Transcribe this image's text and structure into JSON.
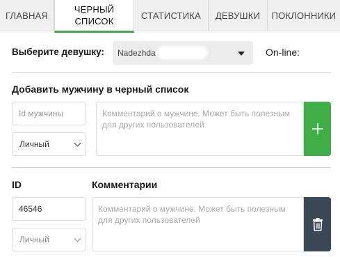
{
  "tabs": [
    {
      "label": "ГЛАВНАЯ"
    },
    {
      "label_line1": "ЧЕРНЫЙ",
      "label_line2": "СПИСОК",
      "active": true
    },
    {
      "label": "СТАТИСТИКА"
    },
    {
      "label": "ДЕВУШКИ"
    },
    {
      "label": "ПОКЛОННИКИ"
    }
  ],
  "girl_select": {
    "label": "Выберите девушку:",
    "value": "Nadezhda S",
    "online_label": "On-line:"
  },
  "add_section": {
    "title": "Добавить мужчину в черный список",
    "id_placeholder": "Id мужчины",
    "type_value": "Личный",
    "comment_placeholder": "Комментарий о мужчине. Может быть полезным для других пользователей",
    "add_icon": "plus-icon"
  },
  "list": {
    "col_id": "ID",
    "col_comments": "Комментарии",
    "rows": [
      {
        "id": "46546",
        "type_value": "Личный",
        "comment_placeholder": "Комментарий о мужчине. Может быть полезным для других пользователей",
        "delete_icon": "trash-icon"
      }
    ]
  },
  "colors": {
    "accent": "#3aac3a",
    "add_button": "#3fae47",
    "delete_button": "#3a4754"
  }
}
